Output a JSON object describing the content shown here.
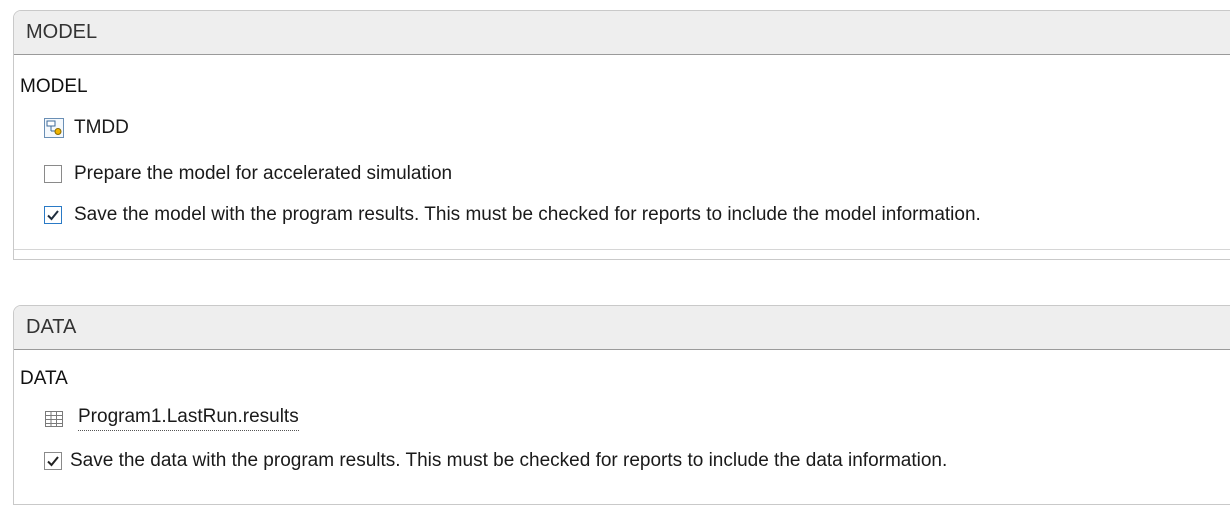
{
  "model_section": {
    "header": "MODEL",
    "title": "MODEL",
    "model_name": "TMDD",
    "prepare_accelerated_label": "Prepare the model for accelerated simulation",
    "prepare_accelerated_checked": false,
    "save_model_label": "Save the model with the program results. This must be checked for reports to include the model information.",
    "save_model_checked": true
  },
  "data_section": {
    "header": "DATA",
    "title": "DATA",
    "data_name": "Program1.LastRun.results",
    "save_data_label": "Save the data with the program results. This must be checked for reports to include the data information.",
    "save_data_checked": true
  },
  "icons": {
    "model": "model-diagram-icon",
    "data": "table-grid-icon",
    "check": "checkmark-icon"
  },
  "colors": {
    "header_bg": "#eeeeee",
    "border": "#c9c9c9",
    "check_blue": "#2a7ac6",
    "check_dark": "#333333"
  }
}
